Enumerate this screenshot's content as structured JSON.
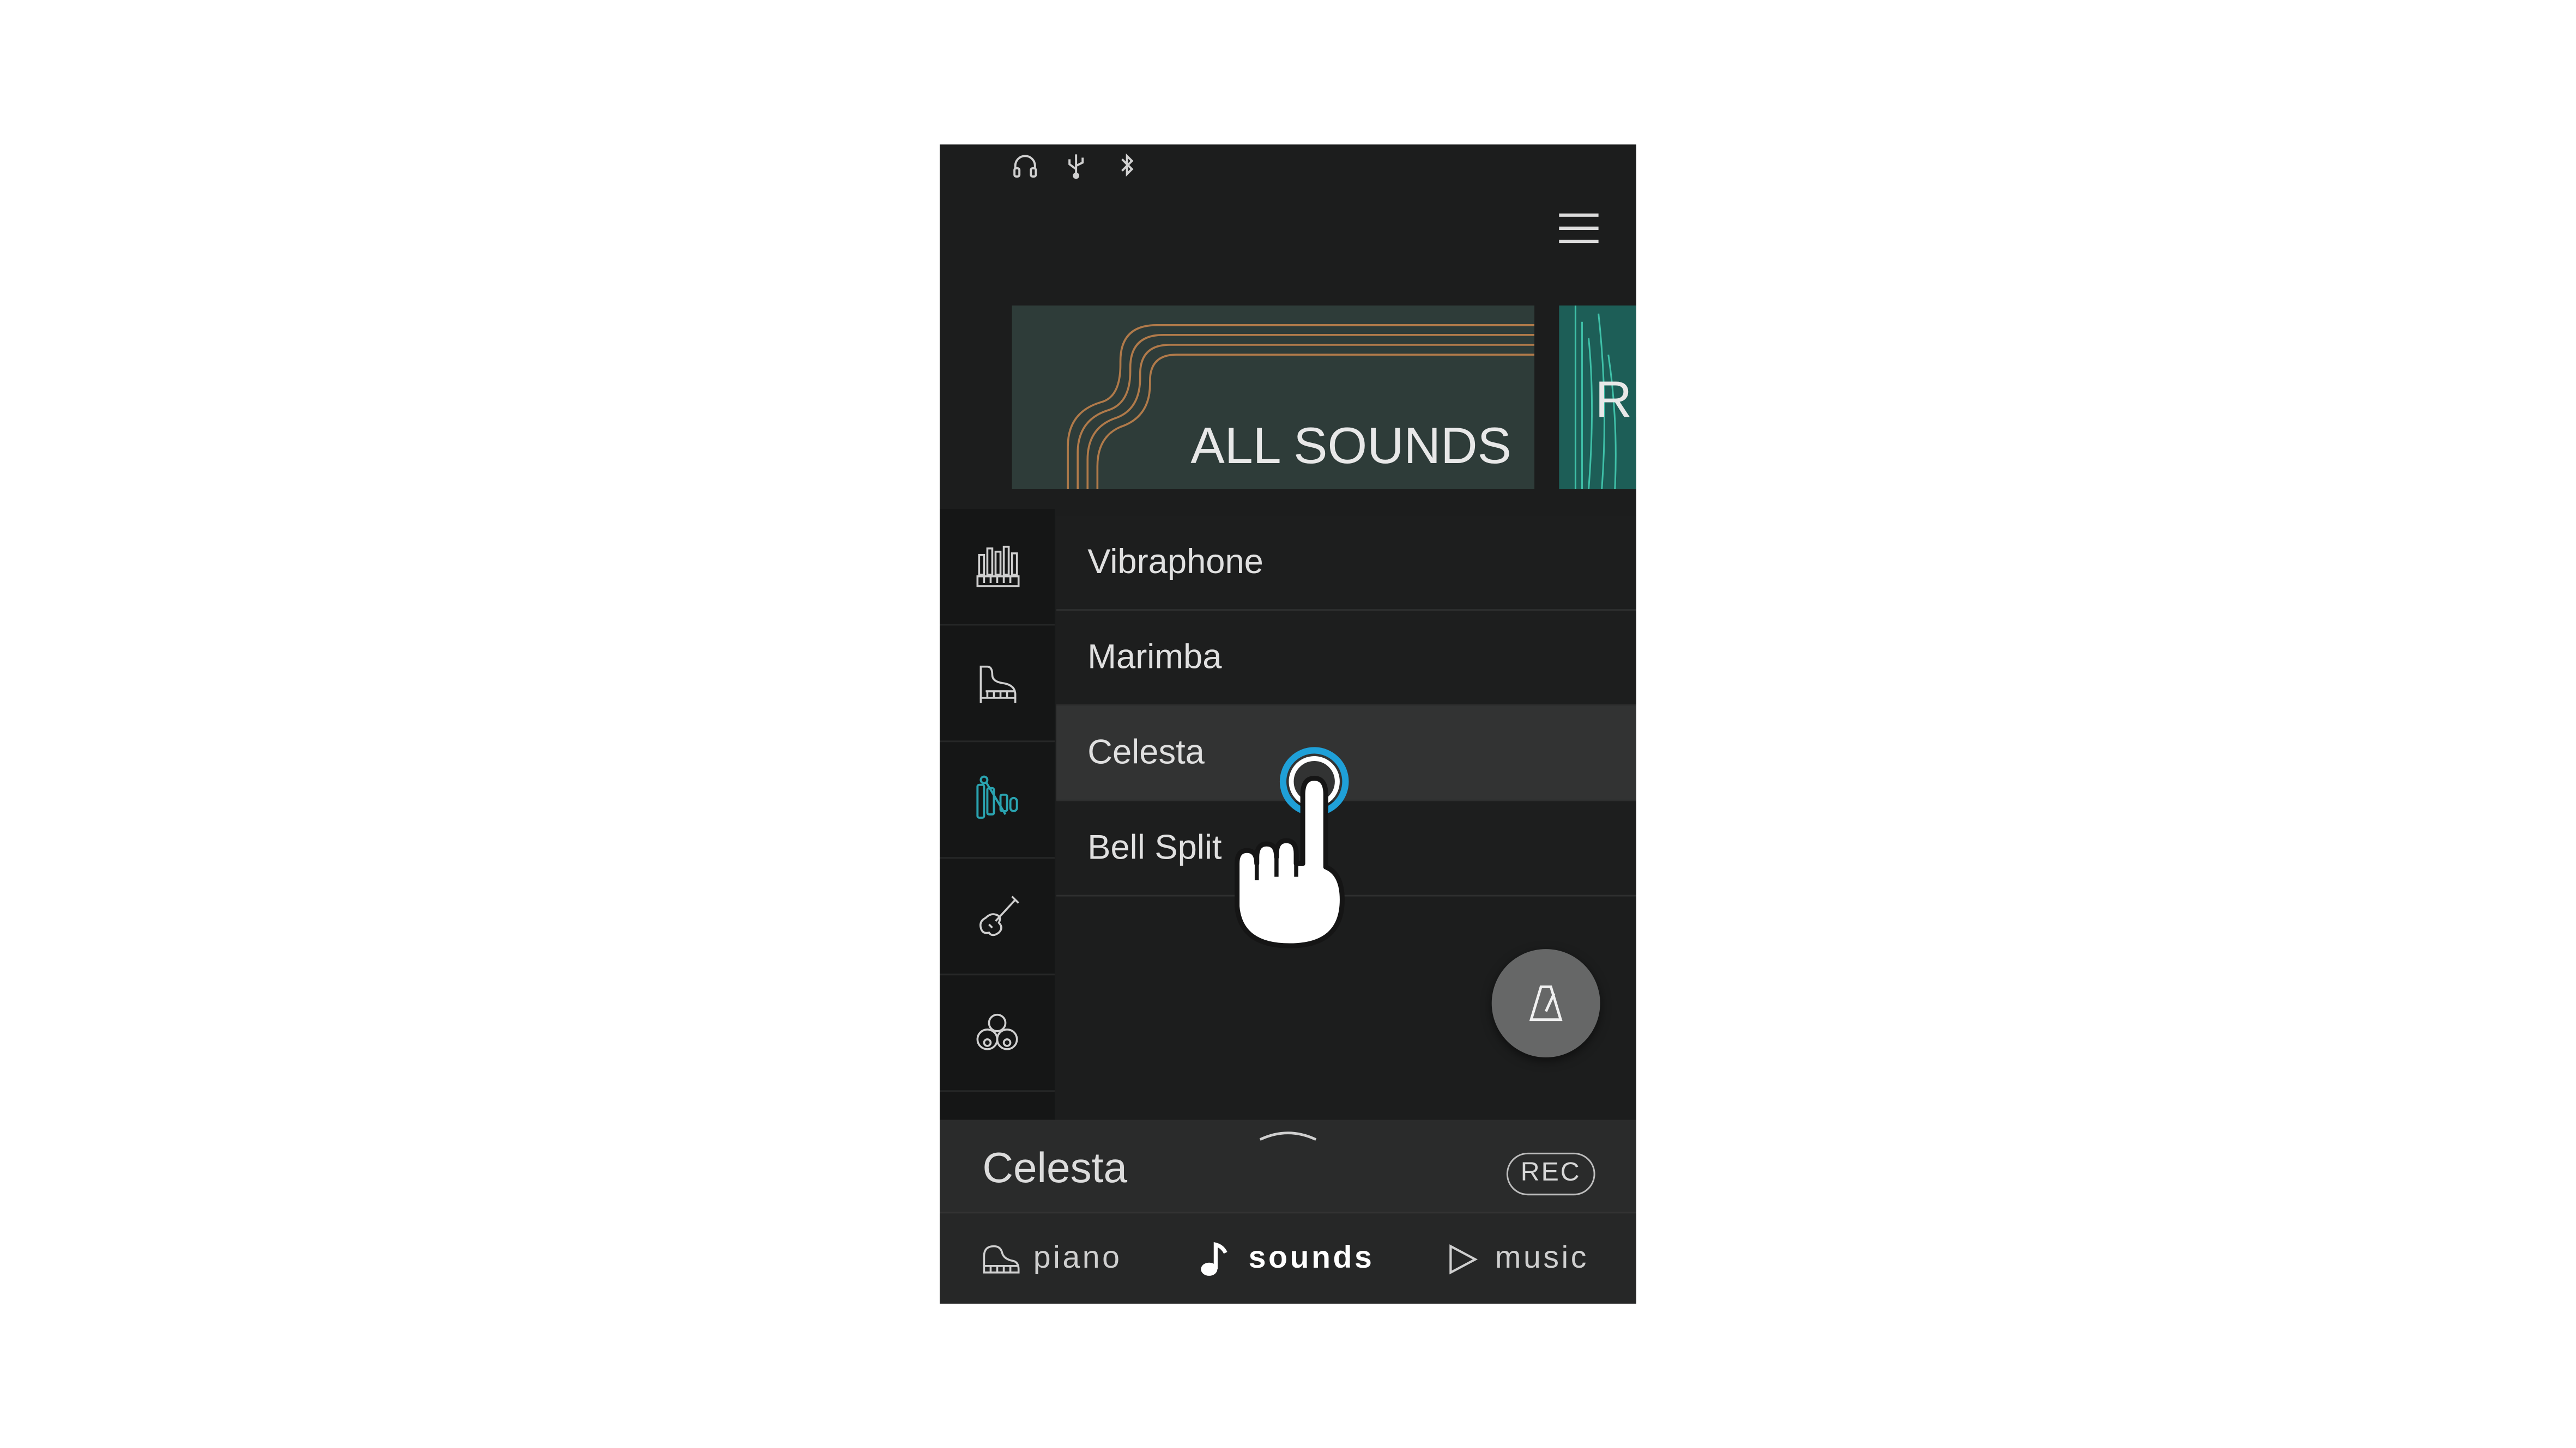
{
  "status_icons": [
    "headphones-icon",
    "usb-icon",
    "bluetooth-icon"
  ],
  "header": {
    "menu_icon": "hamburger-menu-icon"
  },
  "cards": [
    {
      "label": "ALL SOUNDS",
      "color": "#2e3c39"
    },
    {
      "label": "RE",
      "color": "#1d5e57"
    }
  ],
  "categories": [
    {
      "icon": "organ-icon",
      "active": false
    },
    {
      "icon": "grand-piano-icon",
      "active": false
    },
    {
      "icon": "mallet-percussion-icon",
      "active": true
    },
    {
      "icon": "violin-icon",
      "active": false
    },
    {
      "icon": "ensemble-icon",
      "active": false
    }
  ],
  "sounds": [
    {
      "label": "Vibraphone",
      "selected": false
    },
    {
      "label": "Marimba",
      "selected": false
    },
    {
      "label": "Celesta",
      "selected": true
    },
    {
      "label": "Bell Split",
      "selected": false
    }
  ],
  "fab": {
    "icon": "metronome-icon"
  },
  "now_playing": {
    "title": "Celesta",
    "rec_label": "REC"
  },
  "nav": [
    {
      "label": "piano",
      "icon": "piano-icon",
      "active": false
    },
    {
      "label": "sounds",
      "icon": "music-note-icon",
      "active": true
    },
    {
      "label": "music",
      "icon": "play-icon",
      "active": false
    }
  ],
  "colors": {
    "background": "#1c1d1d",
    "accent": "#1fa0d8",
    "active_icon": "#2aa3b0"
  }
}
